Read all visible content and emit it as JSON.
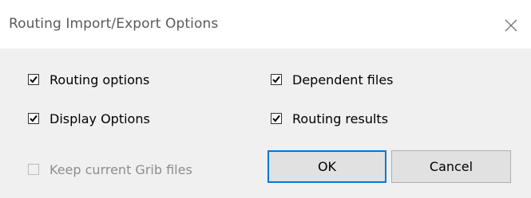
{
  "dialog": {
    "title": "Routing Import/Export Options",
    "close_icon": "close-icon"
  },
  "options": {
    "routing_options": {
      "label": "Routing options",
      "checked": true,
      "enabled": true
    },
    "display_options": {
      "label": "Display Options",
      "checked": true,
      "enabled": true
    },
    "keep_grib_files": {
      "label": "Keep current Grib files",
      "checked": false,
      "enabled": false
    },
    "dependent_files": {
      "label": "Dependent files",
      "checked": true,
      "enabled": true
    },
    "routing_results": {
      "label": "Routing results",
      "checked": true,
      "enabled": true
    }
  },
  "buttons": {
    "ok_label": "OK",
    "cancel_label": "Cancel"
  },
  "colors": {
    "title_bar": "#ffffff",
    "dialog_bg": "#f0f0f0",
    "default_button_border": "#0078d7",
    "disabled_text": "#8d8d8d"
  }
}
